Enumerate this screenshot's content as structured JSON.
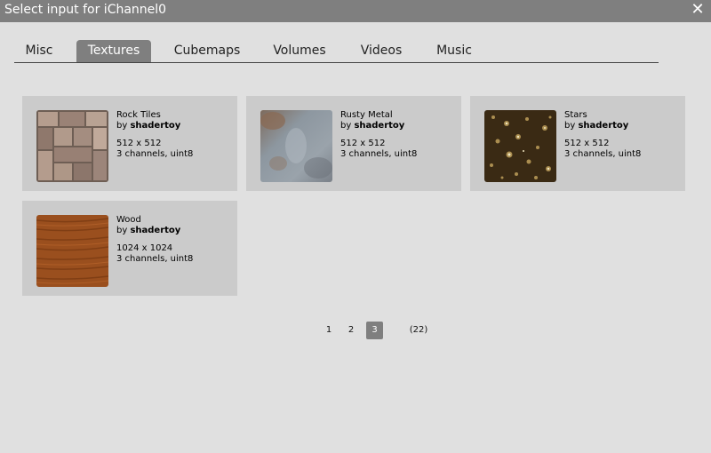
{
  "window": {
    "title": "Select input for iChannel0",
    "close_glyph": "✕"
  },
  "tabs": [
    {
      "label": "Misc",
      "active": false
    },
    {
      "label": "Textures",
      "active": true
    },
    {
      "label": "Cubemaps",
      "active": false
    },
    {
      "label": "Volumes",
      "active": false
    },
    {
      "label": "Videos",
      "active": false
    },
    {
      "label": "Music",
      "active": false
    }
  ],
  "textures": [
    {
      "name": "Rock Tiles",
      "by": "by",
      "author": "shadertoy",
      "size": "512 x 512",
      "format": "3 channels, uint8"
    },
    {
      "name": "Rusty Metal",
      "by": "by",
      "author": "shadertoy",
      "size": "512 x 512",
      "format": "3 channels, uint8"
    },
    {
      "name": "Stars",
      "by": "by",
      "author": "shadertoy",
      "size": "512 x 512",
      "format": "3 channels, uint8"
    },
    {
      "name": "Wood",
      "by": "by",
      "author": "shadertoy",
      "size": "1024 x 1024",
      "format": "3 channels, uint8"
    }
  ],
  "pagination": {
    "pages": [
      "1",
      "2",
      "3"
    ],
    "current": "3",
    "total": "(22)"
  },
  "colors": {
    "titlebar": "#7f7f7f",
    "background": "#e0e0e0",
    "card": "#cbcbcb",
    "active_tab": "#7f7f7f"
  },
  "icons": {
    "close": "close-icon"
  }
}
